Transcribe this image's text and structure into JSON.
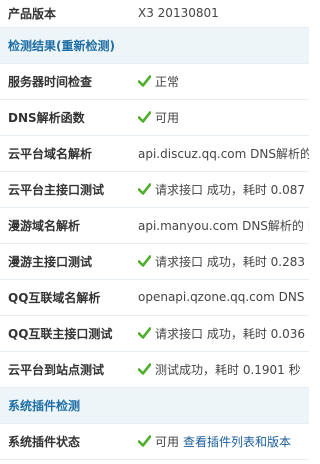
{
  "top": {
    "label": "产品版本",
    "value": "X3 20130801"
  },
  "section1": {
    "title": "检测结果(重新检测)"
  },
  "rows": [
    {
      "label": "服务器时间检查",
      "status_icon": "check-icon",
      "value": "正常"
    },
    {
      "label": "DNS解析函数",
      "status_icon": "check-icon",
      "value": "可用"
    },
    {
      "label": "云平台域名解析",
      "value": "api.discuz.qq.com DNS解析的"
    },
    {
      "label": "云平台主接口测试",
      "status_icon": "check-icon",
      "value": "请求接口 成功，耗时 0.087"
    },
    {
      "label": "漫游域名解析",
      "value": "api.manyou.com DNS解析的 I"
    },
    {
      "label": "漫游主接口测试",
      "status_icon": "check-icon",
      "value": "请求接口 成功，耗时 0.283"
    },
    {
      "label": "QQ互联域名解析",
      "value": "openapi.qzone.qq.com DNS"
    },
    {
      "label": "QQ互联主接口测试",
      "status_icon": "check-icon",
      "value": "请求接口 成功，耗时 0.036"
    },
    {
      "label": "云平台到站点测试",
      "status_icon": "check-icon",
      "value": "测试成功，耗时 0.1901 秒"
    }
  ],
  "section2": {
    "title": "系统插件检测"
  },
  "plugin_row": {
    "label": "系统插件状态",
    "status_icon": "check-icon",
    "value": "可用",
    "link": "查看插件列表和版本"
  },
  "colors": {
    "check": "#4cae2b",
    "section_bg": "#eef5f9",
    "section_text": "#1f6fa5",
    "link": "#1a5d9a"
  }
}
